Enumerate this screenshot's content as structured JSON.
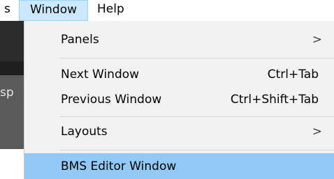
{
  "menubar": {
    "previous_fragment": "s",
    "window_label": "Window",
    "help_label": "Help"
  },
  "background_app": {
    "text_fragment": "sp"
  },
  "window_menu": {
    "items": [
      {
        "label": "Panels",
        "shortcut": "",
        "submenu_arrow": ">"
      },
      {
        "label": "Next Window",
        "shortcut": "Ctrl+Tab",
        "submenu_arrow": ""
      },
      {
        "label": "Previous Window",
        "shortcut": "Ctrl+Shift+Tab",
        "submenu_arrow": ""
      },
      {
        "label": "Layouts",
        "shortcut": "",
        "submenu_arrow": ">"
      },
      {
        "label": "BMS Editor Window",
        "shortcut": "",
        "submenu_arrow": ""
      }
    ],
    "highlighted_item": "BMS Editor Window",
    "colors": {
      "menu_background": "#f2f2f2",
      "highlight": "#91c9f7",
      "menubar_selected": "#cce8ff"
    }
  }
}
